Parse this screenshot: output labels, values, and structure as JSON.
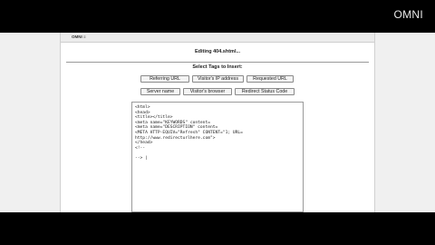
{
  "watermark": "OMNI",
  "header": {
    "logo": "OMNI ≡"
  },
  "page_title": "Editing 404.shtml...",
  "tags_label": "Select Tags to Insert:",
  "tag_buttons": {
    "referring_url": "Referring URL",
    "visitor_ip": "Visitor's IP address",
    "requested_url": "Requested URL",
    "server_name": "Server name",
    "visitor_browser": "Visitor's browser",
    "redirect_status": "Redirect Status Code"
  },
  "editor": {
    "content": "<html>\n<head>\n<title></title>\n<meta name=\"KEYWORDS\" content=\n<meta name=\"DESCRIPTION\" content=\n<META HTTP-EQUIV=\"Refresh\" CONTENT=\"1; URL=\nhttp://www.redirecturlhere.com\">\n</head>\n<!--\n\n--> |"
  }
}
